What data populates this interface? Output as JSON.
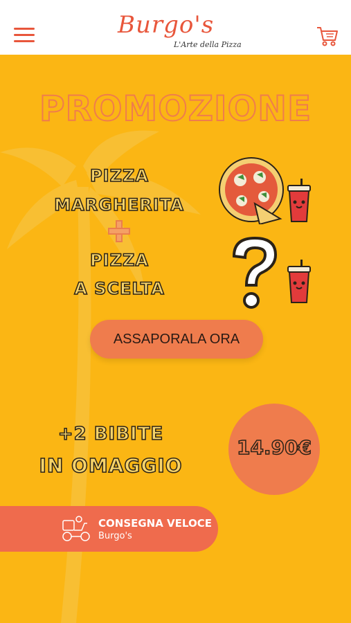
{
  "header": {
    "brand": "Burgo's",
    "tagline": "L'Arte della Pizza",
    "menu_icon": "hamburger-menu-icon",
    "cart_icon": "cart-icon"
  },
  "promo": {
    "title": "PROMOZIONE",
    "line1": "PIZZA",
    "line2": "MARGHERITA",
    "line3": "PIZZA",
    "line4": "A SCELTA",
    "cta": "ASSAPORALA ORA",
    "bonus1": "+2 BIBITE",
    "bonus2": "IN OMAGGIO",
    "price": "14.90€"
  },
  "delivery": {
    "title": "CONSEGNA VELOCE",
    "subtitle": "Burgo's"
  },
  "colors": {
    "background": "#fbb614",
    "accent": "#ef7c4d",
    "brand": "#e8563b"
  }
}
